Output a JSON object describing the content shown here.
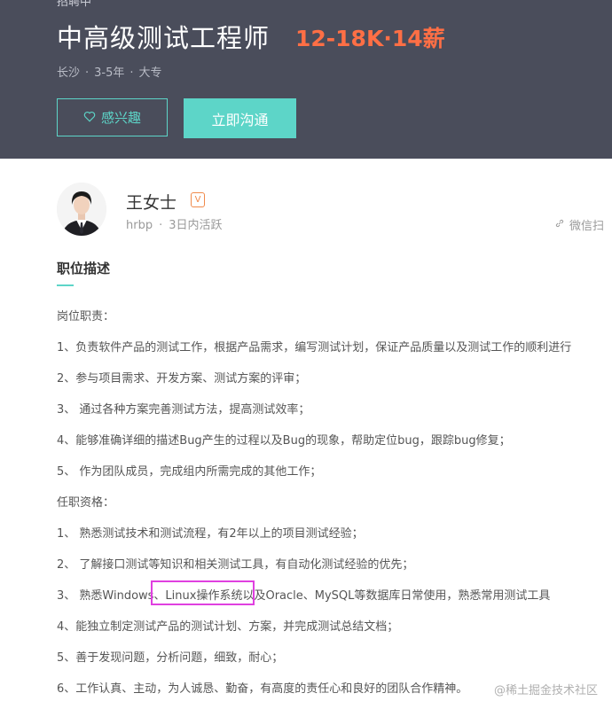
{
  "header": {
    "status": "招聘中",
    "job_title": "中高级测试工程师",
    "salary": "12-18K·14薪",
    "location": "长沙",
    "experience": "3-5年",
    "education": "大专",
    "interest_label": "感兴趣",
    "chat_label": "立即沟通",
    "interest_icon": "heart-outline-icon"
  },
  "recruiter": {
    "name": "王女士",
    "badge": "V",
    "role": "hrbp",
    "activity": "3日内活跃",
    "share_label": "微信扫",
    "share_icon": "link-icon"
  },
  "description": {
    "title": "职位描述",
    "lines": [
      "岗位职责：",
      "1、负责软件产品的测试工作，根据产品需求，编写测试计划，保证产品质量以及测试工作的顺利进行",
      "2、参与项目需求、开发方案、测试方案的评审；",
      "3、 通过各种方案完善测试方法，提高测试效率；",
      "4、能够准确详细的描述Bug产生的过程以及Bug的现象，帮助定位bug，跟踪bug修复；",
      "5、 作为团队成员，完成组内所需完成的其他工作；",
      "任职资格：",
      "1、 熟悉测试技术和测试流程，有2年以上的项目测试经验；",
      "2、 了解接口测试等知识和相关测试工具，有自动化测试经验的优先；",
      "3、 熟悉Windows、Linux操作系统以及Oracle、MySQL等数据库日常使用，熟悉常用测试工具",
      "4、能独立制定测试产品的测试计划、方案，并完成测试总结文档；",
      "5、善于发现问题，分析问题，细致，耐心；",
      "6、工作认真、主动，为人诚恳、勤奋，有高度的责任心和良好的团队合作精神。"
    ]
  },
  "watermark": "@稀土掘金技术社区",
  "colors": {
    "header_bg": "#4a4d5b",
    "accent": "#5dd5c8",
    "salary": "#ff6f45",
    "highlight": "#e040e0"
  }
}
